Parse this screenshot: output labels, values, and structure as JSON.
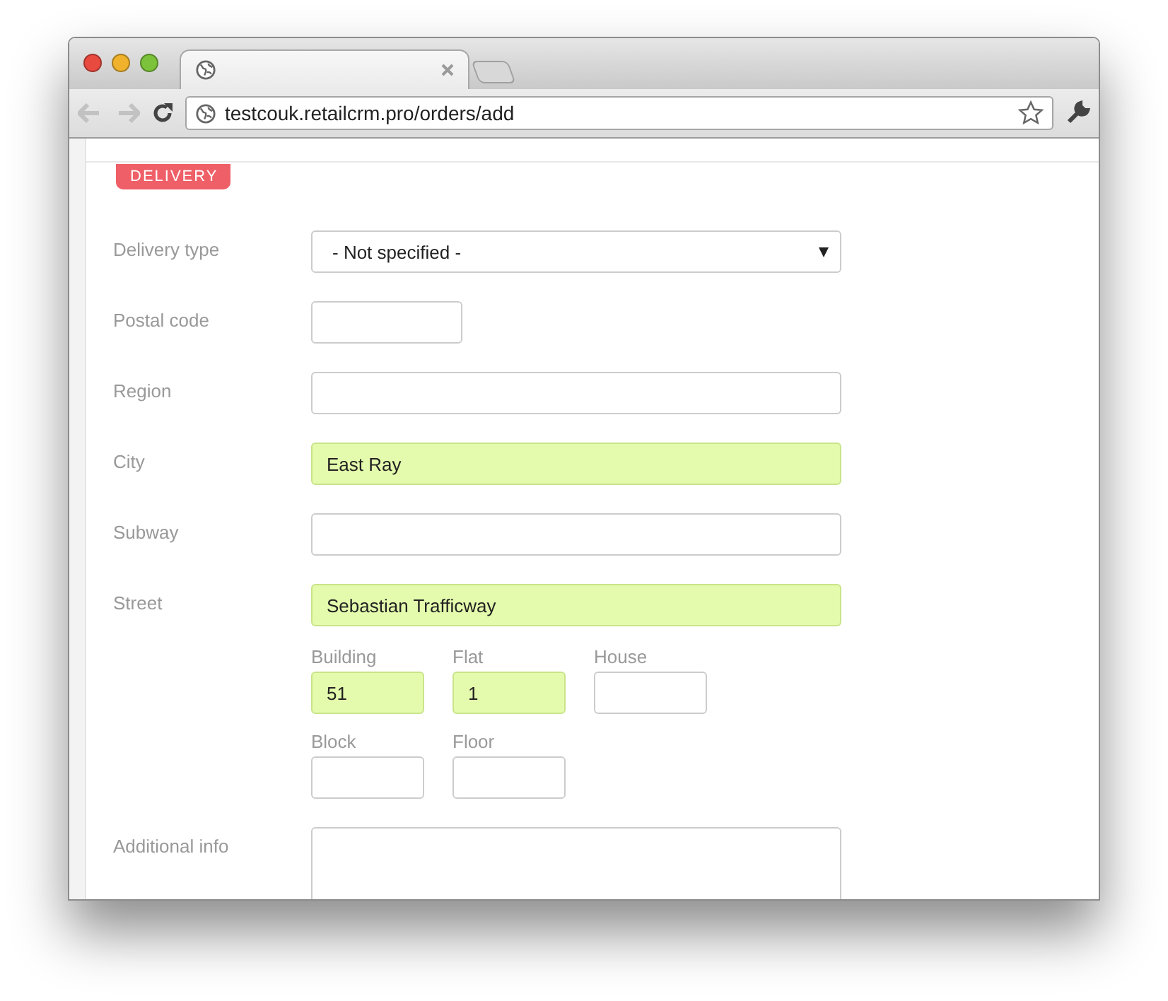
{
  "browser": {
    "address": "testcouk.retailcrm.pro/orders/add",
    "back_disabled": true,
    "forward_disabled": true
  },
  "section": {
    "label": "DELIVERY"
  },
  "fields": [
    {
      "kind": "select",
      "label": "Delivery type",
      "value": "- Not specified -",
      "highlighted": false
    },
    {
      "kind": "short",
      "label": "Postal code",
      "highlighted": false
    },
    {
      "kind": "text",
      "label": "Region",
      "highlighted": false
    },
    {
      "kind": "text",
      "label": "City",
      "value": "East Ray",
      "highlighted": true
    },
    {
      "kind": "text",
      "label": "Subway",
      "highlighted": false
    },
    {
      "kind": "text",
      "label": "Street",
      "value": "Sebastian Trafficway",
      "highlighted": true
    },
    {
      "kind": "group",
      "rows": [
        [
          {
            "label": "Building",
            "value": "51",
            "highlighted": true
          },
          {
            "label": "Flat",
            "value": "1",
            "highlighted": true
          },
          {
            "label": "House",
            "highlighted": false
          }
        ],
        [
          {
            "label": "Block",
            "highlighted": false
          },
          {
            "label": "Floor",
            "highlighted": false
          }
        ]
      ]
    },
    {
      "kind": "textarea",
      "label": "Additional info",
      "highlighted": false
    }
  ]
}
